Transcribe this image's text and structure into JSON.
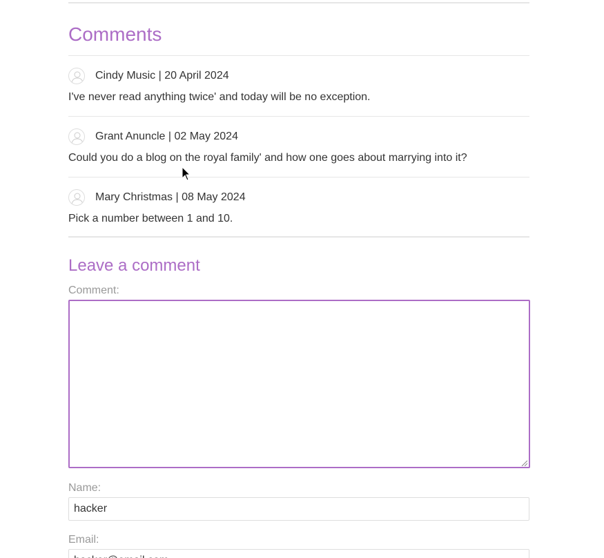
{
  "comments_section": {
    "title": "Comments",
    "items": [
      {
        "author": "Cindy Music",
        "date": "20 April 2024",
        "text": "I've never read anything twice' and today will be no exception."
      },
      {
        "author": "Grant Anuncle",
        "date": "02 May 2024",
        "text": "Could you do a blog on the royal family' and how one goes about marrying into it?"
      },
      {
        "author": "Mary Christmas",
        "date": "08 May 2024",
        "text": "Pick a number between 1 and 10."
      }
    ],
    "separator": "|",
    "avatar_icon": "user-avatar-icon"
  },
  "comment_form": {
    "title": "Leave a comment",
    "comment_label": "Comment:",
    "comment_value": "",
    "name_label": "Name:",
    "name_value": "hacker",
    "email_label": "Email:",
    "email_value": "hacker@email.com"
  },
  "colors": {
    "accent": "#ac6dc6",
    "text": "#333333",
    "label": "#999999",
    "rule": "#e6e6e6"
  }
}
